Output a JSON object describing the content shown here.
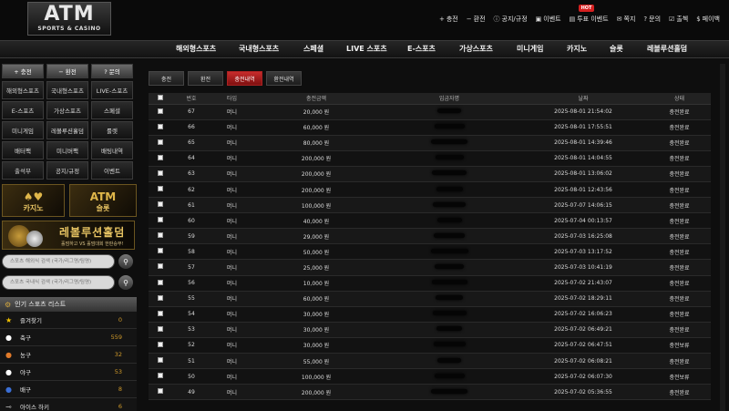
{
  "logo": {
    "main": "ATM",
    "sub": "SPORTS & CASINO"
  },
  "top_menu": [
    {
      "label": "충전",
      "icon": "plus-icon"
    },
    {
      "label": "환전",
      "icon": "minus-icon"
    },
    {
      "label": "공지/규정",
      "icon": "info-icon"
    },
    {
      "label": "이벤트",
      "icon": "gift-icon"
    },
    {
      "label": "투표 이벤트",
      "icon": "ticket-icon",
      "badge": "HOT"
    },
    {
      "label": "쪽지",
      "icon": "message-icon"
    },
    {
      "label": "문의",
      "icon": "question-icon"
    },
    {
      "label": "출첵",
      "icon": "check-icon"
    },
    {
      "label": "페이백",
      "icon": "payback-icon"
    }
  ],
  "nav": [
    "해외형스포츠",
    "국내형스포츠",
    "스페셜",
    "LIVE 스포츠",
    "E-스포츠",
    "가상스포츠",
    "미니게임",
    "카지노",
    "슬롯",
    "레볼루션홀덤"
  ],
  "sidebar": {
    "top_buttons": [
      "+ 충전",
      "− 환전",
      "? 문의"
    ],
    "grid": [
      "해외형스포츠",
      "국내형스포츠",
      "LIVE-스포츠",
      "E-스포츠",
      "가상스포츠",
      "스페셜",
      "미니게임",
      "레볼루션홀덤",
      "룰렛",
      "배터팩",
      "미니버팩",
      "배팅내역",
      "출석부",
      "공지/규정",
      "이벤트"
    ],
    "banner_casino": "카지노",
    "banner_slot": "슬롯",
    "banner_slot_top": "ATM",
    "banner_holdem": {
      "title": "레볼루션홀덤",
      "subtitle": "홀덤하고 VS 홀덤대회 한판승부!"
    },
    "search_placeholders": [
      "스포츠 해외식 검색 (국가/리그명/팀명)",
      "스포츠 국내식 검색 (국가/리그명/팀명)"
    ],
    "sports_list_title": "인기 스포츠 리스트",
    "sports": [
      {
        "name": "즐겨찾기",
        "count": "0",
        "icon": "star-icon",
        "color": "#f2c200"
      },
      {
        "name": "축구",
        "count": "559",
        "icon": "soccer-ball-icon",
        "color": "#ffffff"
      },
      {
        "name": "농구",
        "count": "32",
        "icon": "basketball-icon",
        "color": "#e07a2a"
      },
      {
        "name": "야구",
        "count": "53",
        "icon": "baseball-icon",
        "color": "#ffffff"
      },
      {
        "name": "배구",
        "count": "8",
        "icon": "volleyball-icon",
        "color": "#3b6fd6"
      },
      {
        "name": "아이스 하키",
        "count": "6",
        "icon": "hockey-icon",
        "color": "#bbbbbb"
      }
    ]
  },
  "tabs": [
    {
      "label": "충전",
      "active": false
    },
    {
      "label": "환전",
      "active": false
    },
    {
      "label": "충전내역",
      "active": true
    },
    {
      "label": "환전내역",
      "active": false
    }
  ],
  "table": {
    "headers": [
      "",
      "번호",
      "타입",
      "충전금액",
      "입금자명",
      "날짜",
      "상태"
    ],
    "rows": [
      {
        "no": "67",
        "type": "머니",
        "amount": "20,000 원",
        "date": "2025-08-01 21:54:02",
        "status": "충전완료"
      },
      {
        "no": "66",
        "type": "머니",
        "amount": "60,000 원",
        "date": "2025-08-01 17:55:51",
        "status": "충전완료"
      },
      {
        "no": "65",
        "type": "머니",
        "amount": "80,000 원",
        "date": "2025-08-01 14:39:46",
        "status": "충전완료"
      },
      {
        "no": "64",
        "type": "머니",
        "amount": "200,000 원",
        "date": "2025-08-01 14:04:55",
        "status": "충전완료"
      },
      {
        "no": "63",
        "type": "머니",
        "amount": "200,000 원",
        "date": "2025-08-01 13:06:02",
        "status": "충전완료"
      },
      {
        "no": "62",
        "type": "머니",
        "amount": "200,000 원",
        "date": "2025-08-01 12:43:56",
        "status": "충전완료"
      },
      {
        "no": "61",
        "type": "머니",
        "amount": "100,000 원",
        "date": "2025-07-07 14:06:15",
        "status": "충전완료"
      },
      {
        "no": "60",
        "type": "머니",
        "amount": "40,000 원",
        "date": "2025-07-04 00:13:57",
        "status": "충전완료"
      },
      {
        "no": "59",
        "type": "머니",
        "amount": "29,000 원",
        "date": "2025-07-03 16:25:08",
        "status": "충전완료"
      },
      {
        "no": "58",
        "type": "머니",
        "amount": "50,000 원",
        "date": "2025-07-03 13:17:52",
        "status": "충전완료"
      },
      {
        "no": "57",
        "type": "머니",
        "amount": "25,000 원",
        "date": "2025-07-03 10:41:19",
        "status": "충전완료"
      },
      {
        "no": "56",
        "type": "머니",
        "amount": "10,000 원",
        "date": "2025-07-02 21:43:07",
        "status": "충전완료"
      },
      {
        "no": "55",
        "type": "머니",
        "amount": "60,000 원",
        "date": "2025-07-02 18:29:11",
        "status": "충전완료"
      },
      {
        "no": "54",
        "type": "머니",
        "amount": "30,000 원",
        "date": "2025-07-02 16:06:23",
        "status": "충전완료"
      },
      {
        "no": "53",
        "type": "머니",
        "amount": "30,000 원",
        "date": "2025-07-02 06:49:21",
        "status": "충전완료"
      },
      {
        "no": "52",
        "type": "머니",
        "amount": "30,000 원",
        "date": "2025-07-02 06:47:51",
        "status": "충전보류"
      },
      {
        "no": "51",
        "type": "머니",
        "amount": "55,000 원",
        "date": "2025-07-02 06:08:21",
        "status": "충전완료"
      },
      {
        "no": "50",
        "type": "머니",
        "amount": "100,000 원",
        "date": "2025-07-02 06:07:30",
        "status": "충전보류"
      },
      {
        "no": "49",
        "type": "머니",
        "amount": "200,000 원",
        "date": "2025-07-02 05:36:55",
        "status": "충전완료"
      }
    ]
  }
}
